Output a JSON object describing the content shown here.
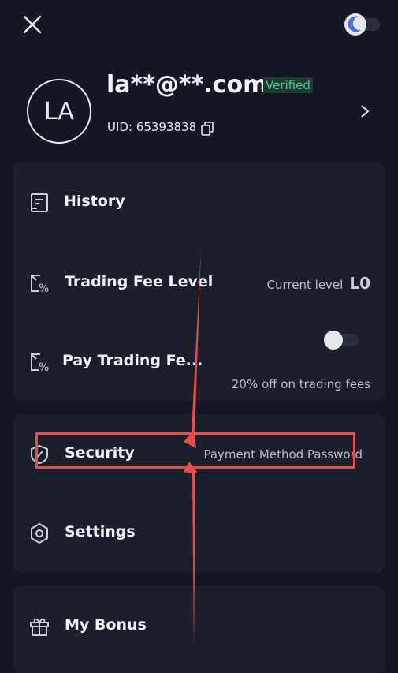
{
  "header": {
    "close_icon": "close-icon",
    "theme_toggle_icon": "moon-icon"
  },
  "profile": {
    "avatar_initials": "LA",
    "email": "la**@**.com",
    "verified_badge": "Verified",
    "uid": "UID: 65393838"
  },
  "menu_group_1": {
    "history": {
      "label": "History"
    },
    "trading_fee_level": {
      "label": "Trading Fee Level",
      "right_text": "Current level",
      "level": "L0"
    },
    "pay_trading_fee": {
      "label": "Pay Trading Fe...",
      "subtext": "20% off on trading fees"
    }
  },
  "menu_group_2": {
    "security": {
      "label": "Security",
      "right_text": "Payment Method Password"
    },
    "settings": {
      "label": "Settings"
    }
  },
  "menu_group_3": {
    "my_bonus": {
      "label": "My Bonus"
    }
  },
  "colors": {
    "background": "#131722",
    "card": "#1b1f2b",
    "verified": "#3fcf8e",
    "annotation": "#e74c4c"
  }
}
